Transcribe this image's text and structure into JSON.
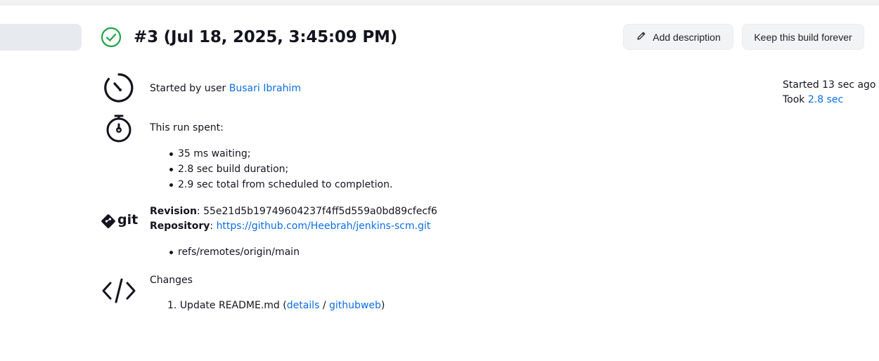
{
  "header": {
    "title": "#3 (Jul 18, 2025, 3:45:09 PM)",
    "status_color": "#1ea446"
  },
  "actions": {
    "add_description": "Add description",
    "keep_forever": "Keep this build forever"
  },
  "cause": {
    "prefix": "Started by user",
    "user": "Busari Ibrahim"
  },
  "timing": {
    "started": "Started 13 sec ago",
    "took_prefix": "Took",
    "took_value": "2.8 sec"
  },
  "run_spent": {
    "heading": "This run spent:",
    "items": [
      "35 ms waiting;",
      "2.8 sec build duration;",
      "2.9 sec total from scheduled to completion."
    ]
  },
  "git": {
    "logo_text": "git",
    "revision_label": "Revision",
    "revision_value": ": 55e21d5b19749604237f4ff5d559a0bd89cfecf6",
    "repository_label": "Repository",
    "repository_colon": ":",
    "repository_url": "https://github.com/Heebrah/jenkins-scm.git",
    "branches": [
      "refs/remotes/origin/main"
    ]
  },
  "changes": {
    "heading": "Changes",
    "items": [
      {
        "number": "1.",
        "message": "Update README.md",
        "open": "(",
        "details": "details",
        "sep": "/",
        "githubweb": "githubweb",
        "close": ")"
      }
    ]
  },
  "icons": {
    "status": "check-circle-icon",
    "add_description": "pencil-icon",
    "cause": "timer-icon",
    "run_spent": "stopwatch-icon",
    "git": "git-logo-icon",
    "changes": "code-icon"
  },
  "colors": {
    "link": "#0b6ee6",
    "success": "#1ea446"
  }
}
